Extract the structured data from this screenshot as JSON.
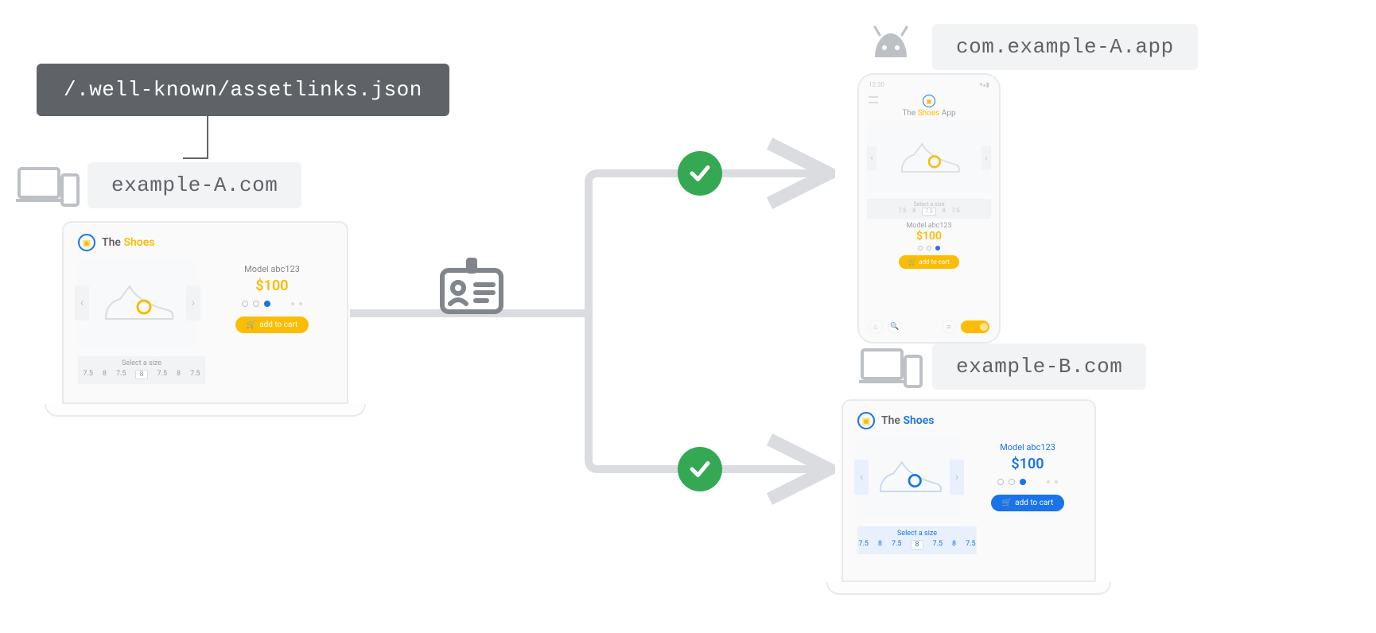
{
  "labels": {
    "assetlinks_path": "/.well-known/assetlinks.json",
    "site_a": "example-A.com",
    "app_package": "com.example-A.app",
    "site_b": "example-B.com"
  },
  "shop_a": {
    "brand_prefix": "The ",
    "brand_accent": "Shoes",
    "model": "Model abc123",
    "price": "$100",
    "cta": "add to cart",
    "size_label": "Select a size",
    "sizes": [
      "7.5",
      "8",
      "7.5",
      "8",
      "7.5",
      "8",
      "7.5"
    ],
    "active_size_index": 3
  },
  "shop_b": {
    "brand_prefix": "The ",
    "brand_accent": "Shoes",
    "model": "Model abc123",
    "price": "$100",
    "cta": "add to cart",
    "size_label": "Select a size",
    "sizes": [
      "7.5",
      "8",
      "7.5",
      "8",
      "7.5",
      "8",
      "7.5"
    ],
    "active_size_index": 3
  },
  "app": {
    "clock": "12:30",
    "brand_prefix": "The ",
    "brand_accent": "Shoes",
    "brand_suffix": " App",
    "model": "Model abc123",
    "price": "$100",
    "cta": "add to cart",
    "size_label": "Select a size",
    "sizes": [
      "7.5",
      "8",
      "7.5",
      "8",
      "7.5"
    ],
    "active_size_index": 2
  }
}
